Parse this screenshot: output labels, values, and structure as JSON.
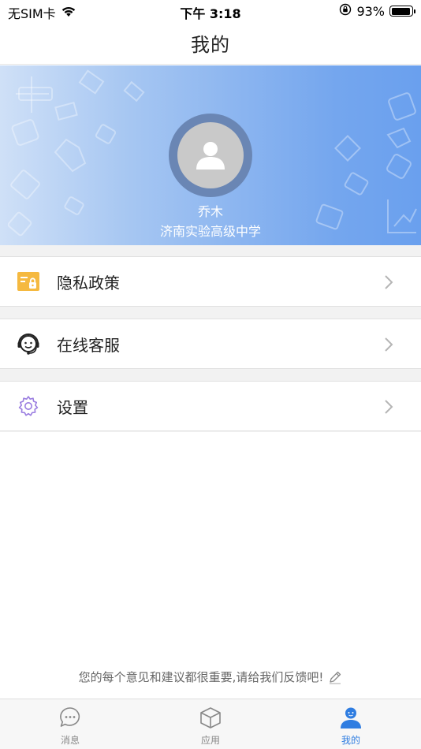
{
  "status_bar": {
    "carrier": "无SIM卡",
    "time": "下午 3:18",
    "battery_percent": "93%",
    "battery_level": 0.93
  },
  "nav": {
    "title": "我的"
  },
  "profile": {
    "name": "乔木",
    "school": "济南实验高级中学"
  },
  "menu": {
    "items": [
      {
        "label": "隐私政策",
        "icon": "privacy-policy-icon"
      },
      {
        "label": "在线客服",
        "icon": "customer-service-icon"
      },
      {
        "label": "设置",
        "icon": "settings-gear-icon"
      }
    ]
  },
  "feedback": {
    "text": "您的每个意见和建议都很重要,请给我们反馈吧!"
  },
  "tab_bar": {
    "tabs": [
      {
        "label": "消息",
        "icon": "message-bubble-icon",
        "active": false
      },
      {
        "label": "应用",
        "icon": "app-box-icon",
        "active": false
      },
      {
        "label": "我的",
        "icon": "profile-person-icon",
        "active": true
      }
    ]
  },
  "colors": {
    "accent": "#2f7de1",
    "banner_start": "#cfe0f7",
    "banner_end": "#6aa0ee",
    "privacy_icon": "#f5b940",
    "settings_icon": "#9a7de0"
  }
}
